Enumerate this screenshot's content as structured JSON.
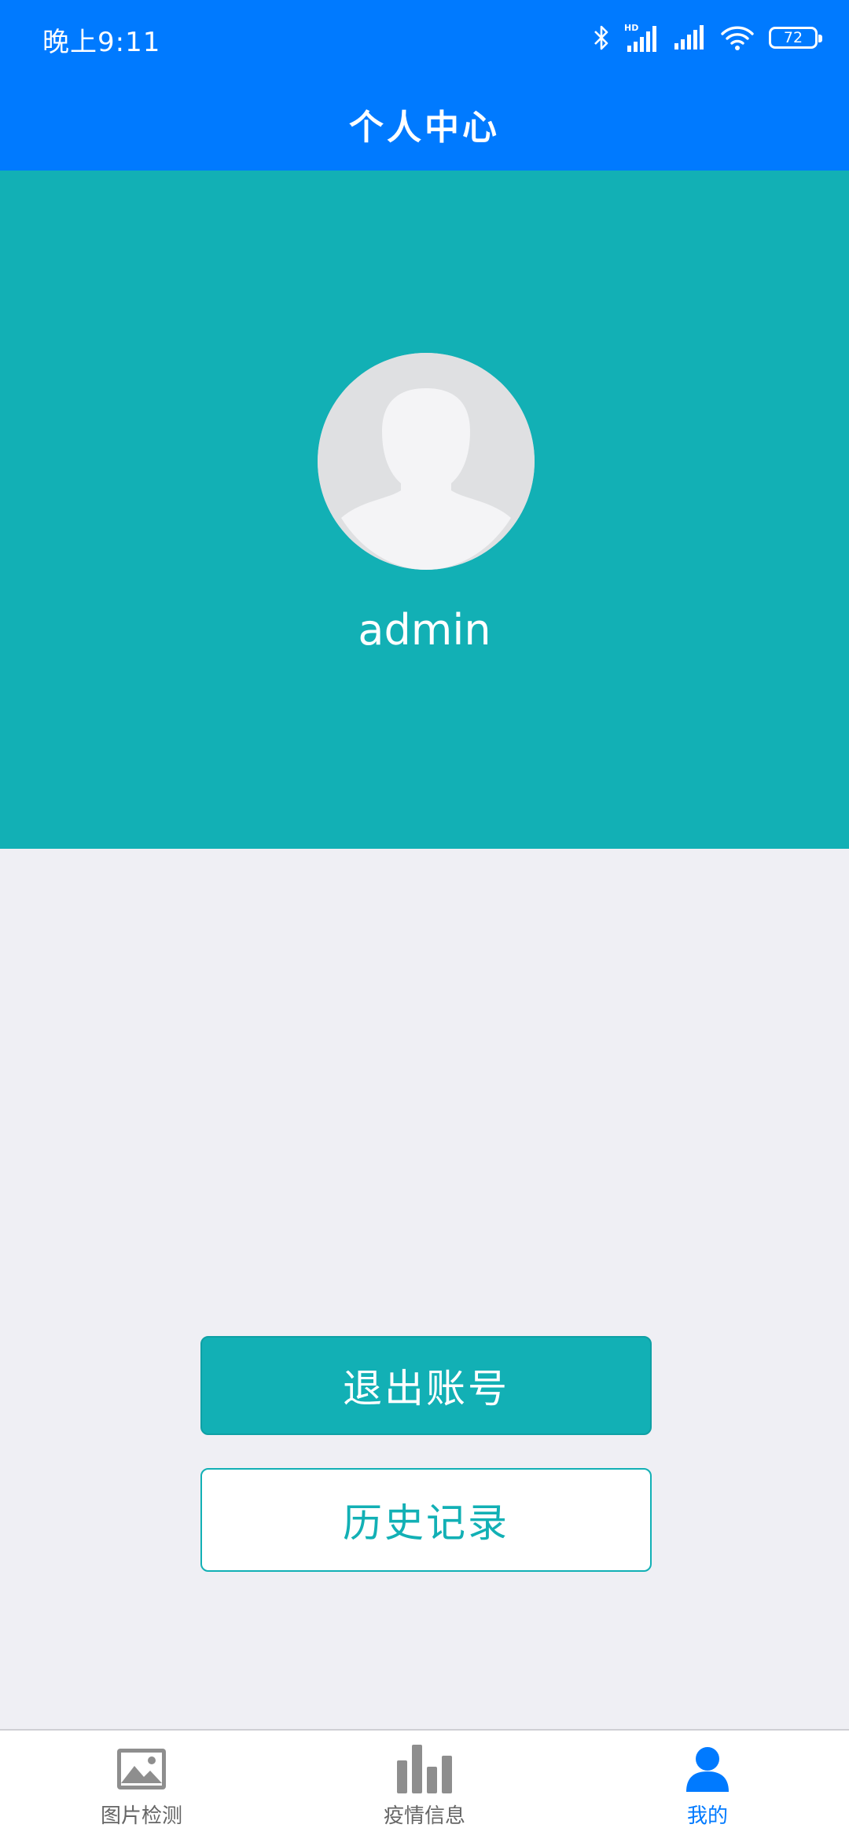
{
  "status_bar": {
    "time": "晚上9:11",
    "battery": "72",
    "icons": [
      "bluetooth-icon",
      "hd-signal-icon",
      "signal-icon",
      "wifi-icon",
      "battery-icon"
    ]
  },
  "header": {
    "title": "个人中心"
  },
  "profile": {
    "username": "admin",
    "avatar_icon": "default-avatar-icon"
  },
  "actions": {
    "logout_label": "退出账号",
    "history_label": "历史记录"
  },
  "tabbar": {
    "tabs": [
      {
        "label": "图片检测",
        "icon": "image-icon",
        "active": false
      },
      {
        "label": "疫情信息",
        "icon": "bar-chart-icon",
        "active": false
      },
      {
        "label": "我的",
        "icon": "user-icon",
        "active": true
      }
    ]
  },
  "colors": {
    "header_blue": "#007aff",
    "teal": "#12b0b5",
    "background": "#efeff4",
    "tab_inactive": "#888888",
    "tab_active": "#007aff"
  }
}
